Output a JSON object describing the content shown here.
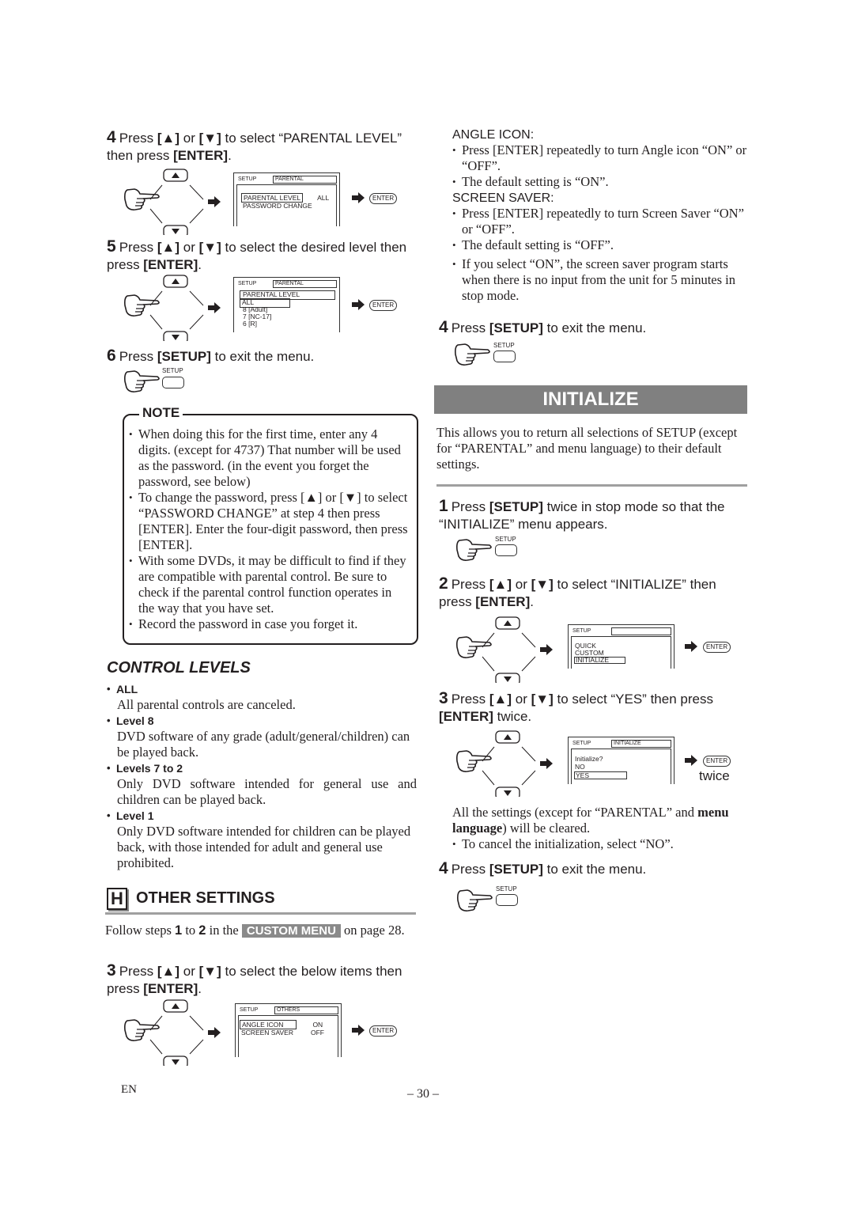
{
  "left": {
    "step4": {
      "num": "4",
      "text_a": "Press ",
      "key_up": "[▲]",
      "or": " or ",
      "key_down": "[▼]",
      "text_b": " to select “PARENTAL LEVEL” then press ",
      "enter": "[ENTER]",
      "end": "."
    },
    "osd1": {
      "header": "SETUP",
      "tab": "PARENTAL",
      "rows": [
        {
          "label": "PARENTAL LEVEL",
          "value": "ALL",
          "selected": true
        },
        {
          "label": "PASSWORD CHANGE",
          "value": "",
          "selected": false
        }
      ]
    },
    "step5": {
      "num": "5",
      "text_a": "Press ",
      "key_up": "[▲]",
      "or": " or ",
      "key_down": "[▼]",
      "text_b": " to select the desired level then press ",
      "enter": "[ENTER]",
      "end": "."
    },
    "osd2": {
      "header": "SETUP",
      "tab": "PARENTAL",
      "title": "PARENTAL LEVEL",
      "rows": [
        "ALL",
        "8 [Adult]",
        "7 [NC-17]",
        "6 [R]"
      ]
    },
    "step6": {
      "num": "6",
      "text_a": "Press ",
      "key": "[SETUP]",
      "text_b": " to exit the menu."
    },
    "setup_label": "SETUP",
    "enter_label": "ENTER",
    "note": {
      "title": "NOTE",
      "items": [
        "When doing this for the first time, enter any 4 digits. (except for 4737) That number will be used as the password. (in the event you forget the password, see below)",
        "To change the password, press [▲] or [▼] to select “PASSWORD CHANGE” at step 4 then press [ENTER]. Enter the four-digit password, then press [ENTER].",
        "With some DVDs, it may be difficult to find if they are compatible with parental control. Be sure to check if the parental control function operates in the way that you have set.",
        "Record the password in case you forget it."
      ]
    },
    "control_levels": {
      "title": "CONTROL LEVELS",
      "items": [
        {
          "label": "ALL",
          "desc": "All parental controls are canceled."
        },
        {
          "label": "Level 8",
          "desc": "DVD software of any grade (adult/general/children) can be played back."
        },
        {
          "label": "Levels 7 to 2",
          "desc": "Only DVD software intended for general use and children can be played back."
        },
        {
          "label": "Level 1",
          "desc": "Only DVD software intended for children can be played back, with those intended for adult and general use prohibited."
        }
      ]
    },
    "other_settings": {
      "letter": "H",
      "title": "OTHER SETTINGS",
      "follow_a": "Follow steps ",
      "follow_n1": "1",
      "follow_to": " to ",
      "follow_n2": "2",
      "follow_b": " in the ",
      "custom_menu": "CUSTOM MENU",
      "follow_c": " on page 28."
    },
    "step3": {
      "num": "3",
      "text_a": "Press ",
      "key_up": "[▲]",
      "or": " or ",
      "key_down": "[▼]",
      "text_b": " to select the below items then press ",
      "enter": "[ENTER]",
      "end": "."
    },
    "osd3": {
      "header": "SETUP",
      "tab": "OTHERS",
      "rows": [
        {
          "label": "ANGLE ICON",
          "value": "ON",
          "selected": true
        },
        {
          "label": "SCREEN SAVER",
          "value": "OFF",
          "selected": false
        }
      ]
    }
  },
  "right": {
    "angle_icon": {
      "title": "ANGLE ICON:",
      "items": [
        "Press [ENTER] repeatedly to turn Angle icon “ON” or “OFF”.",
        "The default setting is “ON”."
      ]
    },
    "screen_saver": {
      "title": "SCREEN SAVER:",
      "items": [
        "Press [ENTER] repeatedly to turn Screen Saver “ON” or “OFF”.",
        "The default setting is “OFF”.",
        "If you select “ON”, the screen saver program starts when there is no input from the unit for 5 minutes in stop mode."
      ]
    },
    "step4a": {
      "num": "4",
      "text_a": "Press ",
      "key": "[SETUP]",
      "text_b": " to exit the menu."
    },
    "initialize": {
      "title": "INITIALIZE",
      "intro": "This allows you to return all selections of SETUP (except for “PARENTAL” and menu language) to their default settings.",
      "step1": {
        "num": "1",
        "text_a": "Press ",
        "key": "[SETUP]",
        "text_b": " twice in stop mode so that the “INITIALIZE” menu appears."
      },
      "step2": {
        "num": "2",
        "text_a": "Press ",
        "key_up": "[▲]",
        "or": " or ",
        "key_down": "[▼]",
        "text_b": " to select “INITIALIZE” then press ",
        "enter": "[ENTER]",
        "end": "."
      },
      "osd4": {
        "header": "SETUP",
        "tab": "",
        "rows": [
          "QUICK",
          "CUSTOM",
          "INITIALIZE"
        ]
      },
      "step3": {
        "num": "3",
        "text_a": "Press ",
        "key_up": "[▲]",
        "or": " or ",
        "key_down": "[▼]",
        "text_b": " to select “YES” then press ",
        "enter": "[ENTER]",
        "end": " twice."
      },
      "osd5": {
        "header": "SETUP",
        "tab": "INITIALIZE",
        "question": "Initialize?",
        "rows": [
          "NO",
          "YES"
        ]
      },
      "twice": "twice",
      "after_a": "All the settings (except for “PARENTAL” and ",
      "after_bold": "menu language",
      "after_b": ") will be cleared.",
      "cancel": "To cancel the initialization, select “NO”.",
      "step4": {
        "num": "4",
        "text_a": "Press ",
        "key": "[SETUP]",
        "text_b": " to exit the menu."
      }
    }
  },
  "footer": {
    "lang": "EN",
    "page": "– 30 –"
  }
}
